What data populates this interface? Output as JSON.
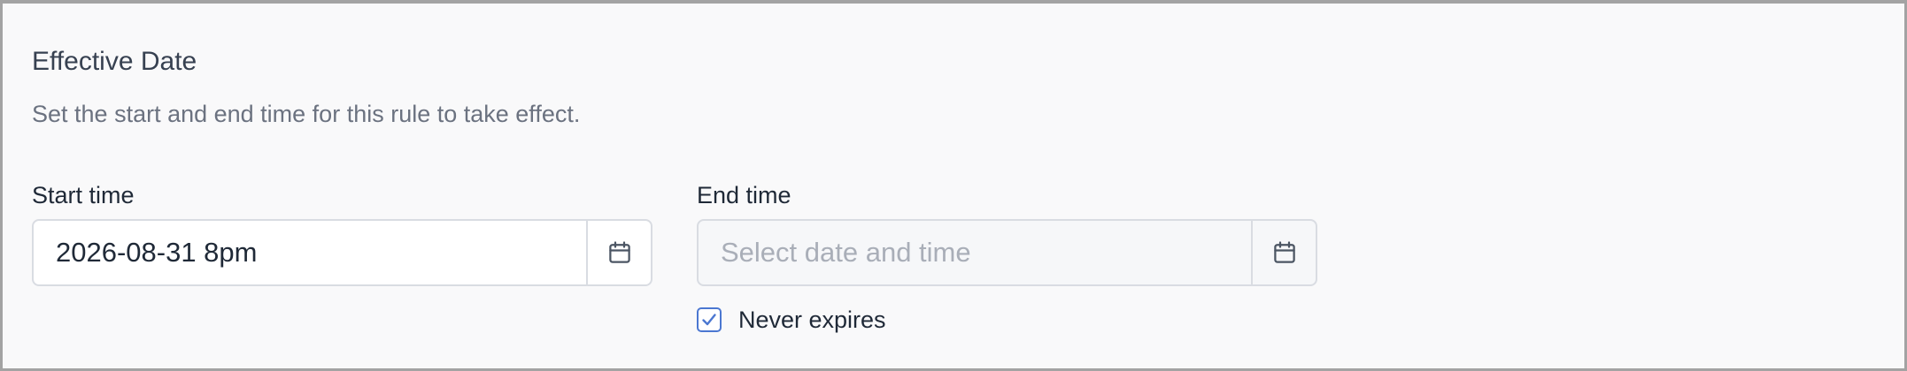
{
  "section": {
    "title": "Effective Date",
    "description": "Set the start and end time for this rule to take effect."
  },
  "start_time": {
    "label": "Start time",
    "value": "2026-08-31 8pm",
    "icon": "calendar-icon"
  },
  "end_time": {
    "label": "End time",
    "value": "",
    "placeholder": "Select date and time",
    "icon": "calendar-icon"
  },
  "never_expires": {
    "label": "Never expires",
    "checked": true
  },
  "colors": {
    "accent": "#4b77d1",
    "title_text": "#374151",
    "muted_text": "#6b7280",
    "placeholder_text": "#a9aeb8",
    "border": "#d9dce2",
    "panel_bg": "#f9f9fa"
  }
}
